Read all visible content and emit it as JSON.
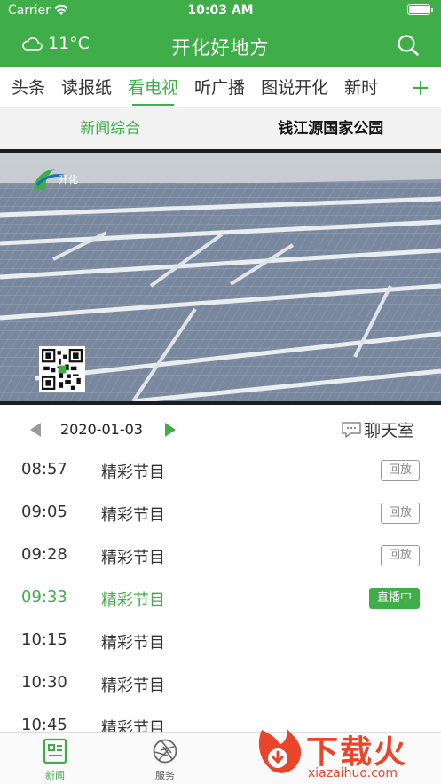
{
  "status": {
    "carrier": "Carrier",
    "time": "10:03 AM"
  },
  "header": {
    "temperature": "11°C",
    "title": "开化好地方"
  },
  "channels": [
    {
      "label": "头条",
      "active": false
    },
    {
      "label": "读报纸",
      "active": false
    },
    {
      "label": "看电视",
      "active": true
    },
    {
      "label": "听广播",
      "active": false
    },
    {
      "label": "图说开化",
      "active": false
    },
    {
      "label": "新时",
      "active": false
    }
  ],
  "add_channel_label": "+",
  "sub_tabs": [
    {
      "label": "新闻综合",
      "active": true
    },
    {
      "label": "钱江源国家公园",
      "active": false
    }
  ],
  "video": {
    "station_text": "开化"
  },
  "schedule": {
    "date": "2020-01-03",
    "chat_room_label": "聊天室",
    "programs": [
      {
        "time": "08:57",
        "name": "精彩节目",
        "badge": "回放",
        "live": false
      },
      {
        "time": "09:05",
        "name": "精彩节目",
        "badge": "回放",
        "live": false
      },
      {
        "time": "09:28",
        "name": "精彩节目",
        "badge": "回放",
        "live": false
      },
      {
        "time": "09:33",
        "name": "精彩节目",
        "badge": "直播中",
        "live": true
      },
      {
        "time": "10:15",
        "name": "精彩节目",
        "badge": "",
        "live": false
      },
      {
        "time": "10:30",
        "name": "精彩节目",
        "badge": "",
        "live": false
      },
      {
        "time": "10:45",
        "name": "精彩节目",
        "badge": "",
        "live": false
      }
    ]
  },
  "tab_bar": {
    "news_label": "新闻",
    "service_label": "服务"
  },
  "watermark": {
    "text": "下载火",
    "url": "xiazaihuo.com"
  },
  "colors": {
    "brand_green": "#3fae49",
    "watermark_red": "#e8452b"
  }
}
